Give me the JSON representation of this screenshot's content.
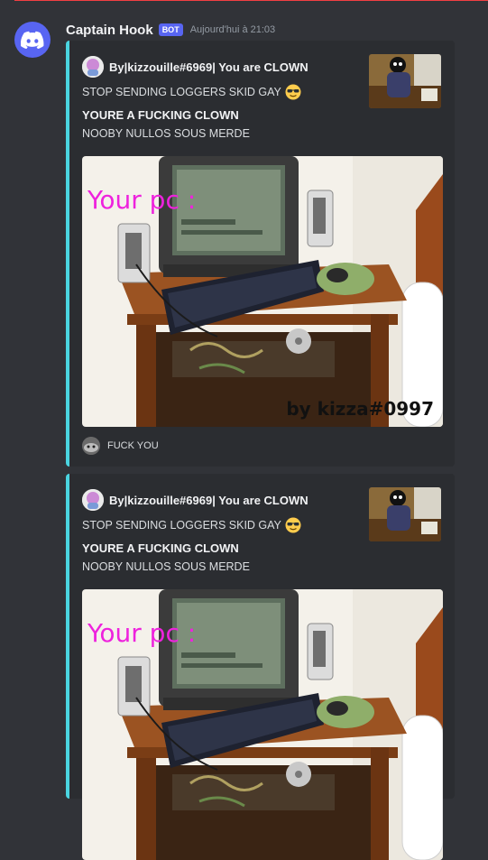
{
  "message": {
    "username": "Captain Hook",
    "bot_tag": "BOT",
    "timestamp": "Aujourd'hui à 21:03",
    "avatar_icon": "discord-logo-icon"
  },
  "colors": {
    "background": "#313338",
    "embed_background": "#2b2d31",
    "embed_border": "#4ad4e0",
    "bot_tag": "#5865f2",
    "overlay_text": "#ee22dd"
  },
  "embeds": [
    {
      "author": "By|kizzouille#6969| You are CLOWN",
      "description": "STOP SENDING LOGGERS SKID GAY",
      "description_emoji": "sunglasses-emoji",
      "field_name": "YOURE A FUCKING CLOWN",
      "field_value": "NOOBY NULLOS SOUS MERDE",
      "image_text": "Your pc :",
      "image_credit": "by kizza#0997",
      "footer": "FUCK YOU"
    },
    {
      "author": "By|kizzouille#6969| You are CLOWN",
      "description": "STOP SENDING LOGGERS SKID GAY",
      "description_emoji": "sunglasses-emoji",
      "field_name": "YOURE A FUCKING CLOWN",
      "field_value": "NOOBY NULLOS SOUS MERDE",
      "image_text": "Your pc :"
    }
  ]
}
